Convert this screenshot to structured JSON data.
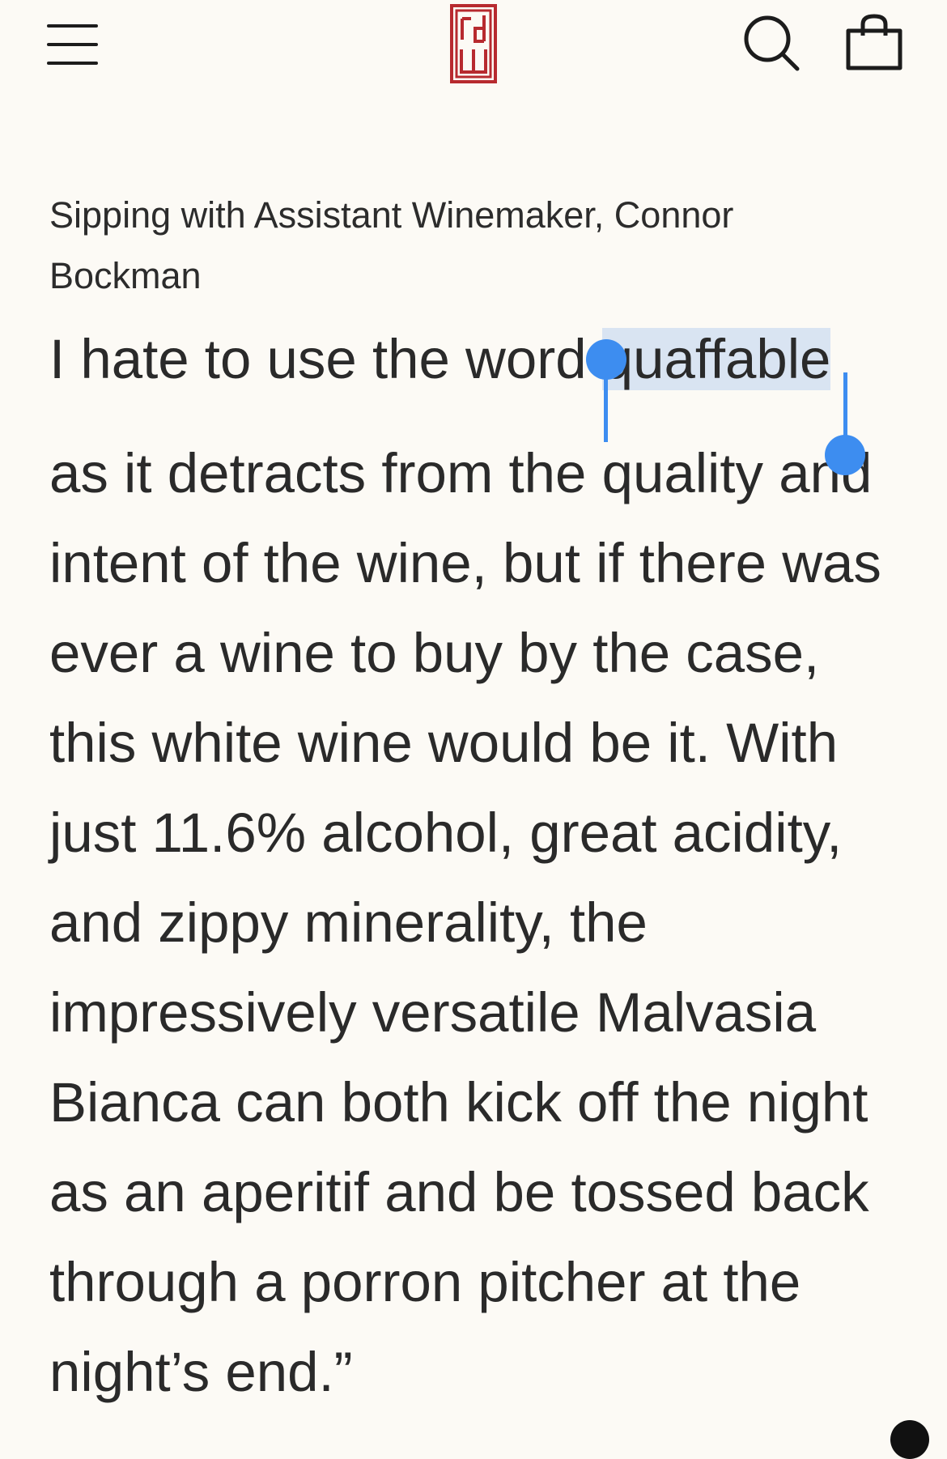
{
  "header": {
    "menu_icon": "hamburger-menu-icon",
    "logo_icon": "brand-logo-icon",
    "search_icon": "search-icon",
    "cart_icon": "shopping-bag-icon",
    "brand_color": "#b72a2f"
  },
  "article": {
    "subtitle_line1": "Sipping with Assistant Winemaker, Connor",
    "subtitle_line2": "Bockman",
    "quote_lines": [
      {
        "before": "I hate to use the word ",
        "selected": "quaffable",
        "after": ""
      },
      {
        "text": "as it detracts from the quality and"
      },
      {
        "text": "intent of the wine, but if there was"
      },
      {
        "text": "ever a wine to buy by the case,"
      },
      {
        "text": "this white wine would be it. With"
      },
      {
        "text": "just 11.6% alcohol, great acidity,"
      },
      {
        "text": "and zippy minerality, the"
      },
      {
        "text": "impressively versatile Malvasia"
      },
      {
        "text": "Bianca can both kick off the night"
      },
      {
        "text": "as an aperitif and be tossed back"
      },
      {
        "text": "through a porron pitcher at the"
      },
      {
        "text": "night’s end.”"
      }
    ]
  },
  "selection": {
    "selected_word": "quaffable",
    "handle_color": "#3d8df0",
    "highlight_color": "#d9e4f2"
  }
}
